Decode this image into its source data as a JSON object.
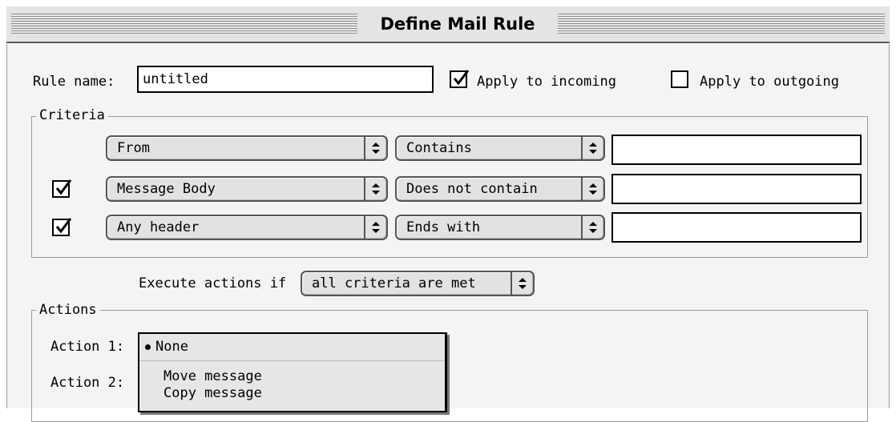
{
  "window": {
    "title": "Define Mail Rule"
  },
  "rule": {
    "name_label": "Rule name:",
    "name_value": "untitled",
    "apply_incoming_label": "Apply to incoming",
    "apply_incoming_checked": true,
    "apply_outgoing_label": "Apply to outgoing",
    "apply_outgoing_checked": false
  },
  "criteria": {
    "title": "Criteria",
    "rows": [
      {
        "enabled": null,
        "field": "From",
        "operator": "Contains",
        "value": ""
      },
      {
        "enabled": true,
        "field": "Message Body",
        "operator": "Does not contain",
        "value": ""
      },
      {
        "enabled": true,
        "field": "Any header",
        "operator": "Ends with",
        "value": ""
      }
    ]
  },
  "execute": {
    "label": "Execute actions if",
    "value": "all criteria are met"
  },
  "actions": {
    "title": "Actions",
    "action1_label": "Action 1:",
    "action2_label": "Action 2:",
    "menu": {
      "selected": "None",
      "items": [
        "Move message",
        "Copy message"
      ]
    }
  },
  "icons": {
    "checkmark": "checkmark-icon",
    "popup_arrows": "up-down-arrows-icon",
    "selected_bullet": "bullet-icon"
  }
}
